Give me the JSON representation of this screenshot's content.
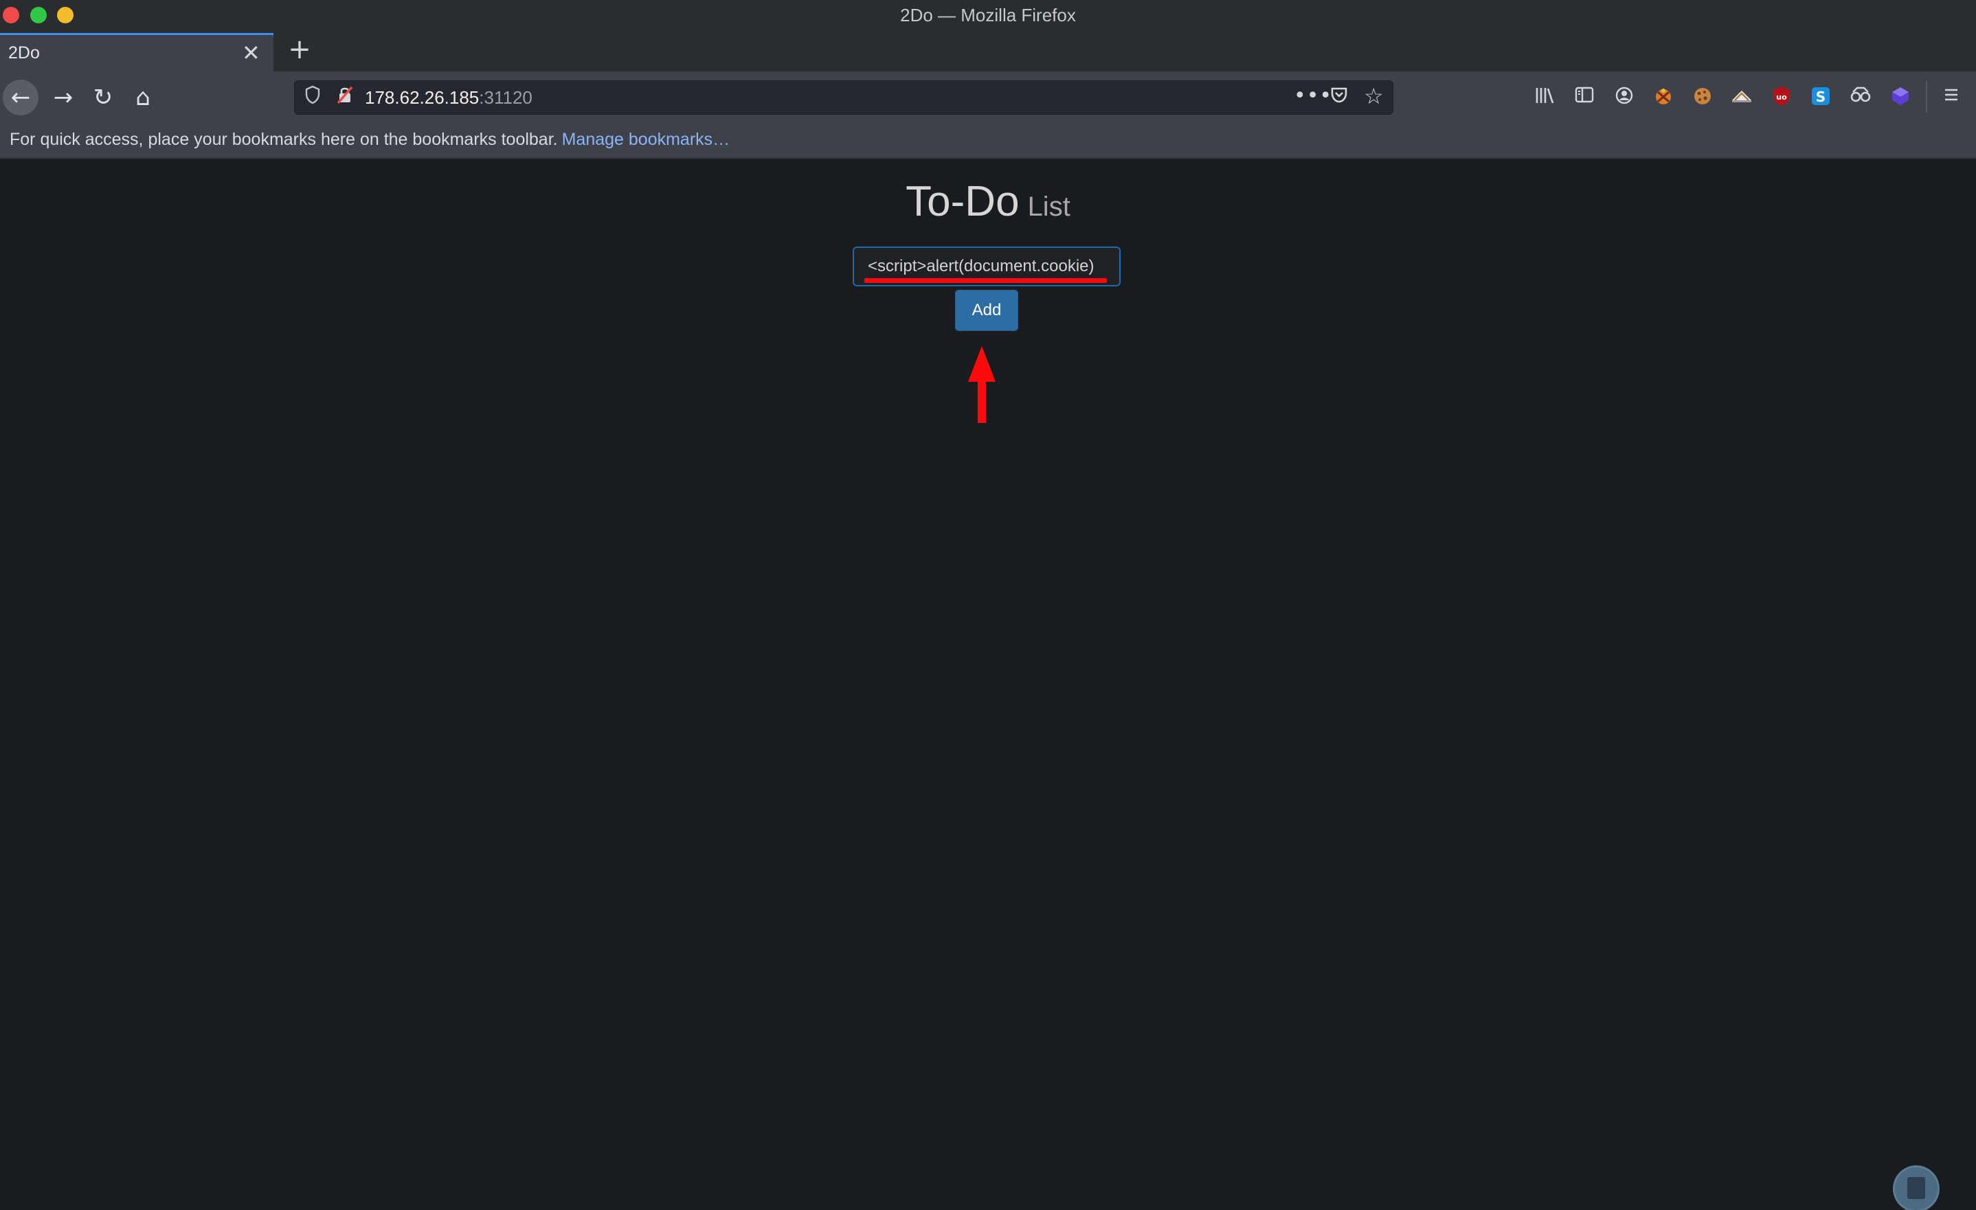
{
  "window": {
    "title": "2Do — Mozilla Firefox"
  },
  "tabs": [
    {
      "title": "2Do"
    }
  ],
  "tab_close_glyph": "✕",
  "new_tab_glyph": "+",
  "nav": {
    "back_icon": "back-arrow-icon",
    "forward_icon": "forward-arrow-icon",
    "reload_icon": "reload-icon",
    "home_icon": "home-icon",
    "back_glyph": "←",
    "forward_glyph": "→",
    "reload_glyph": "↻",
    "home_glyph": "⌂"
  },
  "urlbar": {
    "host": "178.62.26.185",
    "port": ":31120",
    "page_actions_glyph": "•••",
    "pocket_glyph": "♡",
    "bookmark_star_glyph": "☆"
  },
  "toolbar_extensions": [
    "library-icon",
    "sidebar-icon",
    "account-icon",
    "cookie-extension-icon",
    "cookie-editor-icon",
    "wappalyzer-icon",
    "ublock-origin-icon",
    "s-extension-icon",
    "spy-glasses-icon",
    "purple-cube-icon",
    "menu-icon"
  ],
  "bookmarks_bar": {
    "message": "For quick access, place your bookmarks here on the bookmarks toolbar.",
    "link": "Manage bookmarks…"
  },
  "page": {
    "heading_main": "To-Do",
    "heading_sub": "List",
    "todo_input_value": "<script>alert(document.cookie)",
    "add_button_label": "Add"
  },
  "colors": {
    "page_background": "#1a1b1e",
    "annotation_red": "#ff0a0a",
    "add_button": "#2e6da4",
    "link": "#8ab4f8"
  }
}
